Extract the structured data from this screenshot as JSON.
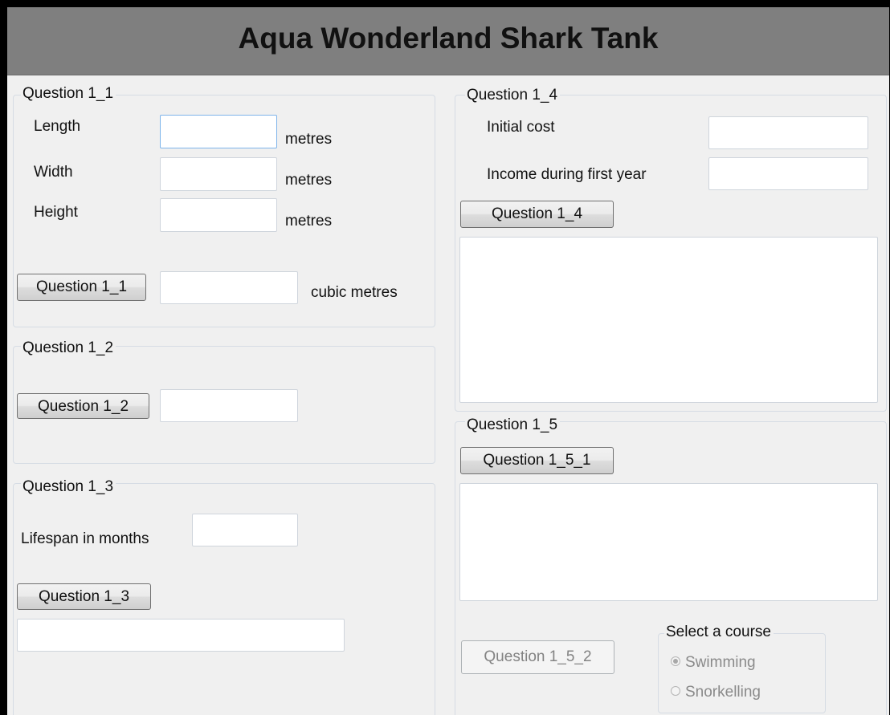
{
  "window": {
    "title": "Aqua Wonderland Shark Tank"
  },
  "q1_1": {
    "legend": "Question 1_1",
    "length_label": "Length",
    "width_label": "Width",
    "height_label": "Height",
    "unit_metres": "metres",
    "button": "Question 1_1",
    "unit_cubic": "cubic metres",
    "length_value": "",
    "width_value": "",
    "height_value": "",
    "result_value": ""
  },
  "q1_2": {
    "legend": "Question 1_2",
    "button": "Question 1_2",
    "result_value": ""
  },
  "q1_3": {
    "legend": "Question 1_3",
    "lifespan_label": "Lifespan in months",
    "lifespan_value": "",
    "button": "Question 1_3",
    "result_value": ""
  },
  "q1_4": {
    "legend": "Question 1_4",
    "initial_cost_label": "Initial cost",
    "income_label": "Income during first year",
    "initial_cost_value": "",
    "income_value": "",
    "button": "Question 1_4",
    "output_text": ""
  },
  "q1_5": {
    "legend": "Question 1_5",
    "button_1": "Question 1_5_1",
    "output_text": "",
    "button_2": "Question 1_5_2",
    "course_group": "Select a course",
    "options": [
      "Swimming",
      "Snorkelling"
    ],
    "selected": "Swimming"
  }
}
